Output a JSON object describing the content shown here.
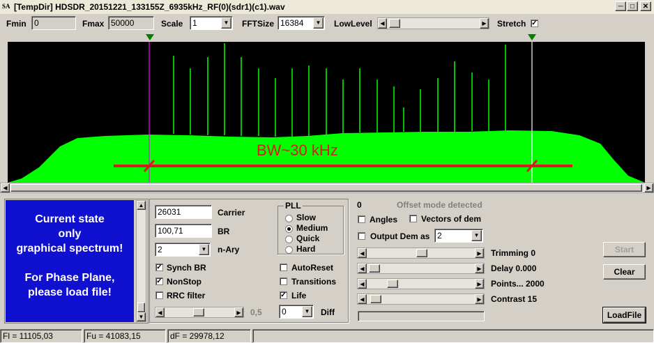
{
  "window": {
    "title": "[TempDir] HDSDR_20151221_133155Z_6935kHz_RF(0)(sdr1)(c1).wav",
    "app_icon": "SA"
  },
  "toolbar": {
    "fmin_label": "Fmin",
    "fmin_value": "0",
    "fmax_label": "Fmax",
    "fmax_value": "50000",
    "scale_label": "Scale",
    "scale_value": "1",
    "fftsize_label": "FFTSize",
    "fftsize_value": "16384",
    "lowlevel_label": "LowLevel",
    "lowlevel": 0.03,
    "stretch_label": "Stretch",
    "stretch_checked": true
  },
  "spectrum": {
    "annotation": "BW~30 kHz",
    "annotation_color": "#d21e1e",
    "fill_color": "#00ff00",
    "marker_color": "#ff00ff"
  },
  "info_panel": {
    "line1": "Current state",
    "line2": "only",
    "line3": "graphical spectrum!",
    "line4": "For Phase Plane,",
    "line5": "please load file!",
    "bg_color": "#1010d0"
  },
  "params": {
    "carrier_value": "26031",
    "carrier_label": "Carrier",
    "br_value": "100,71",
    "br_label": "BR",
    "nary_value": "2",
    "nary_label": "n-Ary",
    "synch_br": "Synch BR",
    "nonstop": "NonStop",
    "rrc_filter": "RRC filter",
    "slider_value": "0,5",
    "pll_title": "PLL",
    "pll_options": [
      "Slow",
      "Medium",
      "Quick",
      "Hard"
    ],
    "pll_selected": "Medium",
    "autoreset": "AutoReset",
    "transitions": "Transitions",
    "life": "Life",
    "diff_value": "0",
    "diff_label": "Diff"
  },
  "demod": {
    "count": "0",
    "offset_text": "Offset mode detected",
    "angles": "Angles",
    "vectors": "Vectors of dem",
    "output_dem_label": "Output Dem as",
    "output_dem_value": "2",
    "trimming": "Trimming 0",
    "delay": "Delay  0.000",
    "points": "Points... 2000",
    "contrast": "Contrast 15"
  },
  "buttons": {
    "start": "Start",
    "clear": "Clear",
    "loadfile": "LoadFile"
  },
  "status": {
    "fl": "Fl = 11105,03",
    "fu": "Fu = 41083,15",
    "df": "dF = 29978,12"
  }
}
